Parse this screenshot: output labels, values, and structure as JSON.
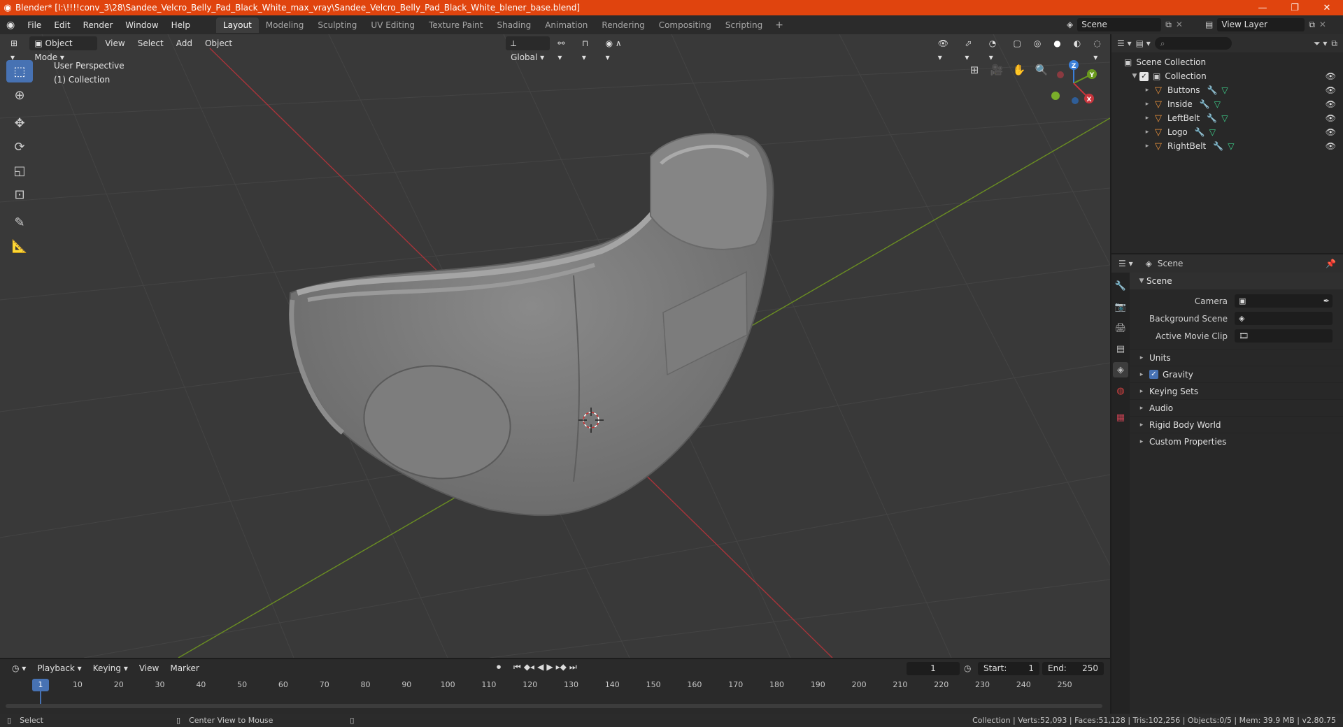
{
  "window": {
    "title": "Blender* [I:\\!!!!conv_3\\28\\Sandee_Velcro_Belly_Pad_Black_White_max_vray\\Sandee_Velcro_Belly_Pad_Black_White_blener_base.blend]",
    "minimize": "—",
    "maximize": "❐",
    "close": "✕"
  },
  "menu": [
    "File",
    "Edit",
    "Render",
    "Window",
    "Help"
  ],
  "workspaces": [
    "Layout",
    "Modeling",
    "Sculpting",
    "UV Editing",
    "Texture Paint",
    "Shading",
    "Animation",
    "Rendering",
    "Compositing",
    "Scripting"
  ],
  "active_workspace": "Layout",
  "scene_name": "Scene",
  "view_layer": "View Layer",
  "viewport": {
    "mode": "Object Mode",
    "menus": [
      "View",
      "Select",
      "Add",
      "Object"
    ],
    "transform_orientation": "Global",
    "perspective_label": "User Perspective",
    "collection_label": "(1) Collection",
    "gizmo_axes": {
      "x": "X",
      "y": "Y",
      "z": "Z"
    }
  },
  "outliner": {
    "root": "Scene Collection",
    "collection": "Collection",
    "objects": [
      "Buttons",
      "Inside",
      "LeftBelt",
      "Logo",
      "RightBelt"
    ]
  },
  "properties": {
    "header": "Scene",
    "panel": "Scene",
    "fields": [
      {
        "label": "Camera",
        "value": ""
      },
      {
        "label": "Background Scene",
        "value": ""
      },
      {
        "label": "Active Movie Clip",
        "value": ""
      }
    ],
    "subpanels": [
      "Units",
      "Gravity",
      "Keying Sets",
      "Audio",
      "Rigid Body World",
      "Custom Properties"
    ]
  },
  "timeline": {
    "menus": [
      "Playback",
      "Keying",
      "View",
      "Marker"
    ],
    "current_frame": "1",
    "start_label": "Start:",
    "start": "1",
    "end_label": "End:",
    "end": "250",
    "ruler_marks": [
      "1",
      "10",
      "20",
      "30",
      "40",
      "50",
      "60",
      "70",
      "80",
      "90",
      "100",
      "110",
      "120",
      "130",
      "140",
      "150",
      "160",
      "170",
      "180",
      "190",
      "200",
      "210",
      "220",
      "230",
      "240",
      "250"
    ]
  },
  "status": {
    "left_action": "Select",
    "middle_action": "Center View to Mouse",
    "stats": "Collection | Verts:52,093 | Faces:51,128 | Tris:102,256 | Objects:0/5 | Mem: 39.9 MB | v2.80.75"
  }
}
